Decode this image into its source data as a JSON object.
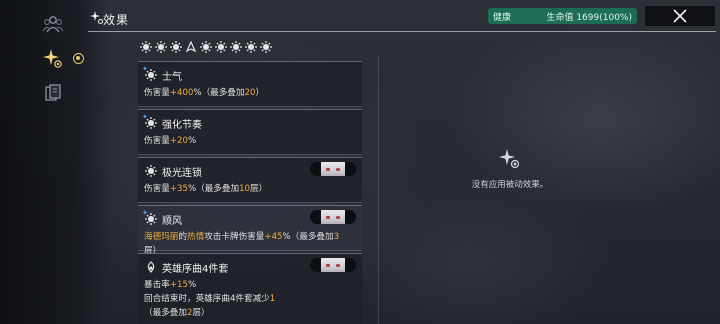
{
  "header": {
    "title": "效果"
  },
  "health": {
    "status": "健康",
    "hp_text": "生命值 1699(100%)",
    "color": "#1d6d56"
  },
  "sidebar": {
    "items": [
      {
        "icon": "team-icon",
        "active": false
      },
      {
        "icon": "effects-sparkle-icon",
        "active": true
      },
      {
        "icon": "cards-icon",
        "active": false
      }
    ]
  },
  "effect_icons": [
    "morale-icon",
    "rhythm-icon",
    "aurora-icon",
    "wind-icon",
    "sun-icon",
    "morale-icon",
    "sun-icon",
    "rhythm-icon",
    "sun-icon"
  ],
  "effects": [
    {
      "name": "士气",
      "icon": "morale-icon",
      "desc_parts": [
        {
          "t": "伤害量",
          "c": ""
        },
        {
          "t": "+400",
          "c": "y"
        },
        {
          "t": "%（最多叠加",
          "c": ""
        },
        {
          "t": "20",
          "c": "y"
        },
        {
          "t": "）",
          "c": ""
        }
      ],
      "has_portrait": false,
      "highlight": false
    },
    {
      "name": "强化节奏",
      "icon": "rhythm-icon",
      "desc_parts": [
        {
          "t": "伤害量",
          "c": ""
        },
        {
          "t": "+20",
          "c": "y"
        },
        {
          "t": "%",
          "c": ""
        }
      ],
      "has_portrait": false,
      "highlight": false
    },
    {
      "name": "极光连锁",
      "icon": "aurora-icon",
      "desc_parts": [
        {
          "t": "伤害量",
          "c": ""
        },
        {
          "t": "+35",
          "c": "y"
        },
        {
          "t": "%（最多叠加",
          "c": ""
        },
        {
          "t": "10",
          "c": "y"
        },
        {
          "t": "层）",
          "c": ""
        }
      ],
      "has_portrait": true,
      "highlight": false
    },
    {
      "name": "顺风",
      "icon": "wind-icon",
      "desc_parts": [
        {
          "t": "海德玛丽",
          "c": "y"
        },
        {
          "t": "的",
          "c": ""
        },
        {
          "t": "热情",
          "c": "y"
        },
        {
          "t": "攻击卡牌伤害量",
          "c": ""
        },
        {
          "t": "+45",
          "c": "y"
        },
        {
          "t": "%（最多叠加",
          "c": ""
        },
        {
          "t": "3",
          "c": "y"
        },
        {
          "t": "层）",
          "c": ""
        }
      ],
      "has_portrait": true,
      "highlight": true
    },
    {
      "name": "英雄序曲4件套",
      "icon": "overture-icon",
      "desc_lines": [
        [
          {
            "t": "暴击率",
            "c": ""
          },
          {
            "t": "+15",
            "c": "y"
          },
          {
            "t": "%",
            "c": ""
          }
        ],
        [
          {
            "t": "回合结束时，英雄序曲4件套减少",
            "c": ""
          },
          {
            "t": "1",
            "c": "y"
          }
        ],
        [
          {
            "t": "（最多叠加",
            "c": ""
          },
          {
            "t": "2",
            "c": "y"
          },
          {
            "t": "层）",
            "c": ""
          }
        ]
      ],
      "has_portrait": true,
      "highlight": false
    }
  ],
  "right_panel": {
    "empty_text": "没有应用被动效果。"
  },
  "colors": {
    "accent_yellow": "#f0a93c",
    "gold": "#e8c76a"
  }
}
